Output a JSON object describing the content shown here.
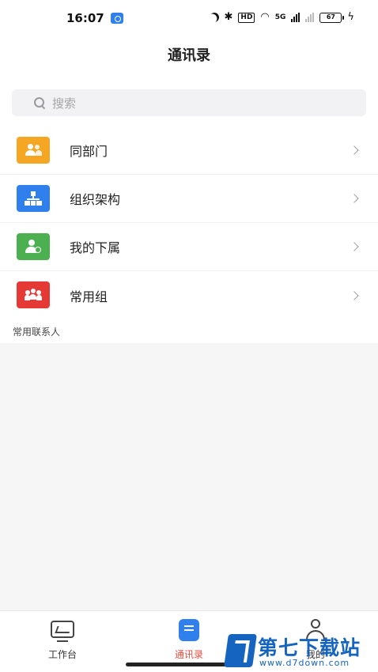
{
  "status_bar": {
    "time": "16:07",
    "hd": "HD",
    "network": "5G",
    "battery": "67"
  },
  "header": {
    "title": "通讯录"
  },
  "search": {
    "placeholder": "搜索"
  },
  "menu": {
    "items": [
      {
        "label": "同部门",
        "icon": "same-department-icon",
        "color": "#f5a623"
      },
      {
        "label": "组织架构",
        "icon": "org-structure-icon",
        "color": "#2f80ed"
      },
      {
        "label": "我的下属",
        "icon": "subordinates-icon",
        "color": "#4caf50"
      },
      {
        "label": "常用组",
        "icon": "common-group-icon",
        "color": "#e53935"
      }
    ]
  },
  "contacts_section": {
    "label": "常用联系人"
  },
  "tabbar": {
    "tabs": [
      {
        "label": "工作台",
        "icon": "workbench-icon",
        "active": false
      },
      {
        "label": "通讯录",
        "icon": "contacts-icon",
        "active": true
      },
      {
        "label": "我的",
        "icon": "profile-icon",
        "active": false
      }
    ],
    "active_color": "#e64a3c"
  },
  "watermark": {
    "title": "第七下载站",
    "url": "www.d7down.com"
  }
}
